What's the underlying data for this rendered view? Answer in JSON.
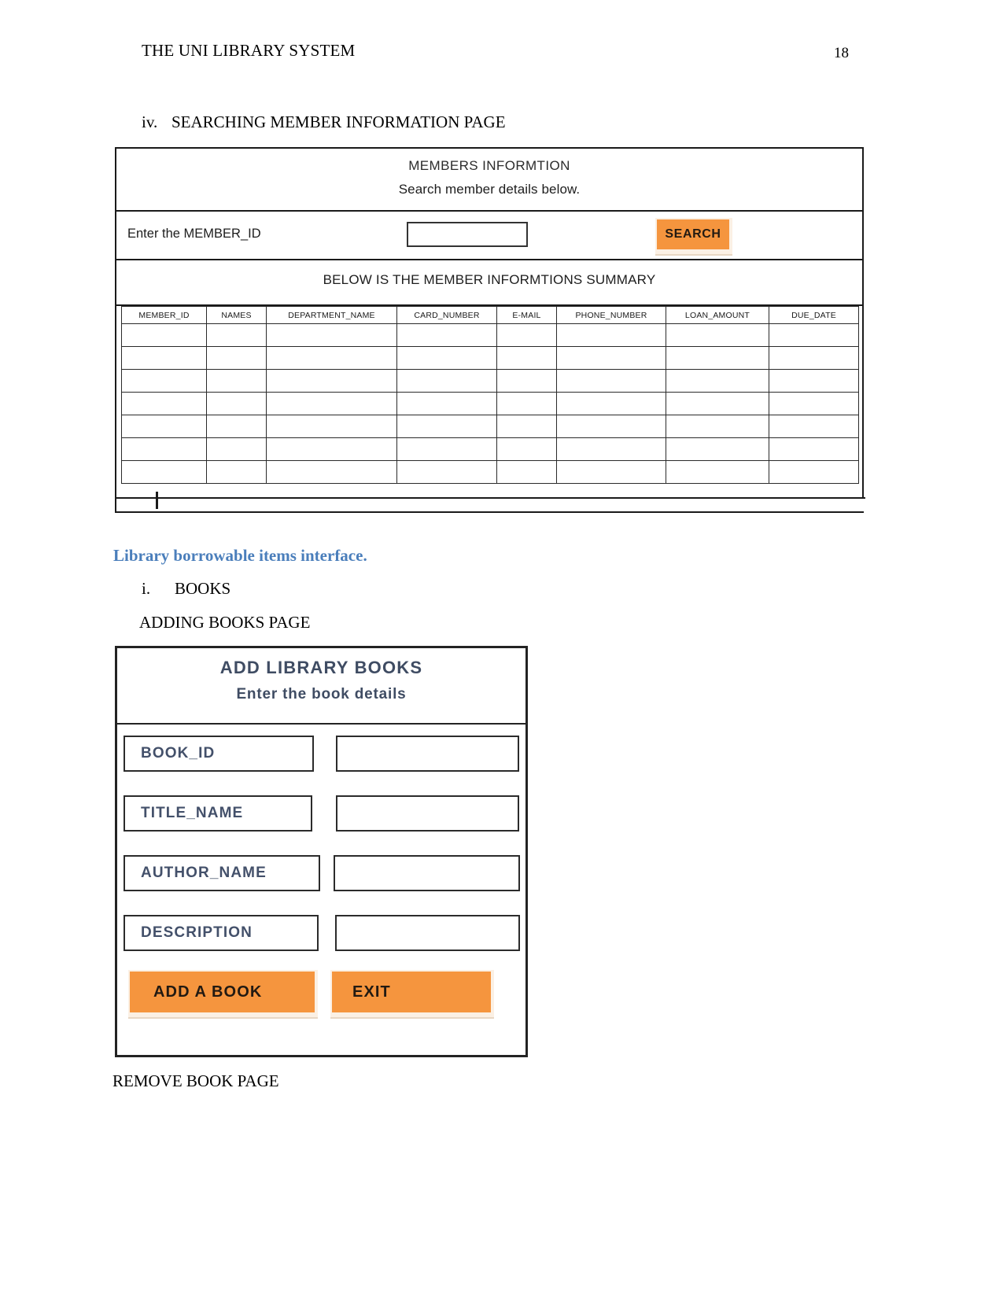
{
  "page": {
    "header_title": "THE UNI LIBRARY SYSTEM",
    "page_number": "18",
    "accent_blue": "#4a7ebb",
    "accent_orange": "#f5953e",
    "mockup_label_blue": "#43506a"
  },
  "sections": {
    "searching_member": {
      "numeral": "iv.",
      "title": "SEARCHING MEMBER INFORMATION PAGE"
    },
    "borrowable_heading": "Library borrowable items interface.",
    "books": {
      "numeral": "i.",
      "title": "BOOKS"
    },
    "adding_books_caption": "ADDING BOOKS PAGE",
    "remove_book_caption": "REMOVE BOOK PAGE"
  },
  "members_mockup": {
    "title": "MEMBERS INFORMTION",
    "subtitle": "Search member details below.",
    "member_id_label": "Enter the MEMBER_ID",
    "member_id_value": "",
    "member_id_placeholder": "",
    "search_button_label": "SEARCH",
    "summary_title": "BELOW IS THE MEMBER INFORMTIONS SUMMARY",
    "table": {
      "columns": [
        "MEMBER_ID",
        "NAMES",
        "DEPARTMENT_NAME",
        "CARD_NUMBER",
        "E-MAIL",
        "PHONE_NUMBER",
        "LOAN_AMOUNT",
        "DUE_DATE"
      ],
      "rows": [
        [
          "",
          "",
          "",
          "",
          "",
          "",
          "",
          ""
        ],
        [
          "",
          "",
          "",
          "",
          "",
          "",
          "",
          ""
        ],
        [
          "",
          "",
          "",
          "",
          "",
          "",
          "",
          ""
        ],
        [
          "",
          "",
          "",
          "",
          "",
          "",
          "",
          ""
        ],
        [
          "",
          "",
          "",
          "",
          "",
          "",
          "",
          ""
        ],
        [
          "",
          "",
          "",
          "",
          "",
          "",
          "",
          ""
        ],
        [
          "",
          "",
          "",
          "",
          "",
          "",
          "",
          ""
        ]
      ]
    }
  },
  "add_books_mockup": {
    "title": "ADD LIBRARY BOOKS",
    "subtitle": "Enter the book details",
    "fields": [
      {
        "label": "BOOK_ID",
        "value": "",
        "placeholder": ""
      },
      {
        "label": "TITLE_NAME",
        "value": "",
        "placeholder": ""
      },
      {
        "label": "AUTHOR_NAME",
        "value": "",
        "placeholder": ""
      },
      {
        "label": "DESCRIPTION",
        "value": "",
        "placeholder": ""
      }
    ],
    "add_button_label": "ADD  A BOOK",
    "exit_button_label": "EXIT"
  }
}
